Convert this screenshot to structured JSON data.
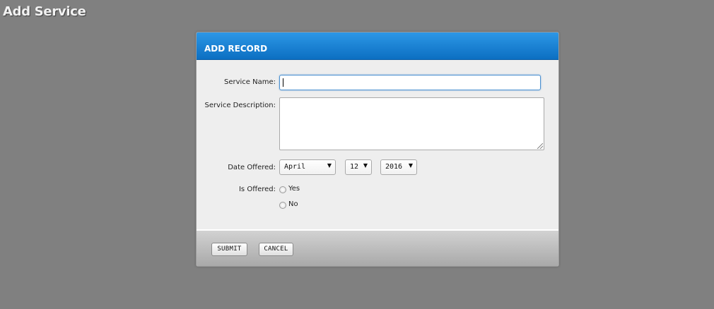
{
  "page": {
    "title": "Add Service"
  },
  "dialog": {
    "title": "ADD RECORD",
    "header_color": "#1a82d4",
    "fields": {
      "service_name": {
        "label": "Service Name:",
        "value": "",
        "focused": true
      },
      "service_description": {
        "label": "Service Description:",
        "value": ""
      },
      "date_offered": {
        "label": "Date Offered:",
        "month": "April",
        "day": "12",
        "year": "2016"
      },
      "is_offered": {
        "label": "Is Offered:",
        "options": [
          "Yes",
          "No"
        ],
        "selected": null
      }
    },
    "footer": {
      "submit_label": "SUBMIT",
      "cancel_label": "CANCEL"
    }
  }
}
